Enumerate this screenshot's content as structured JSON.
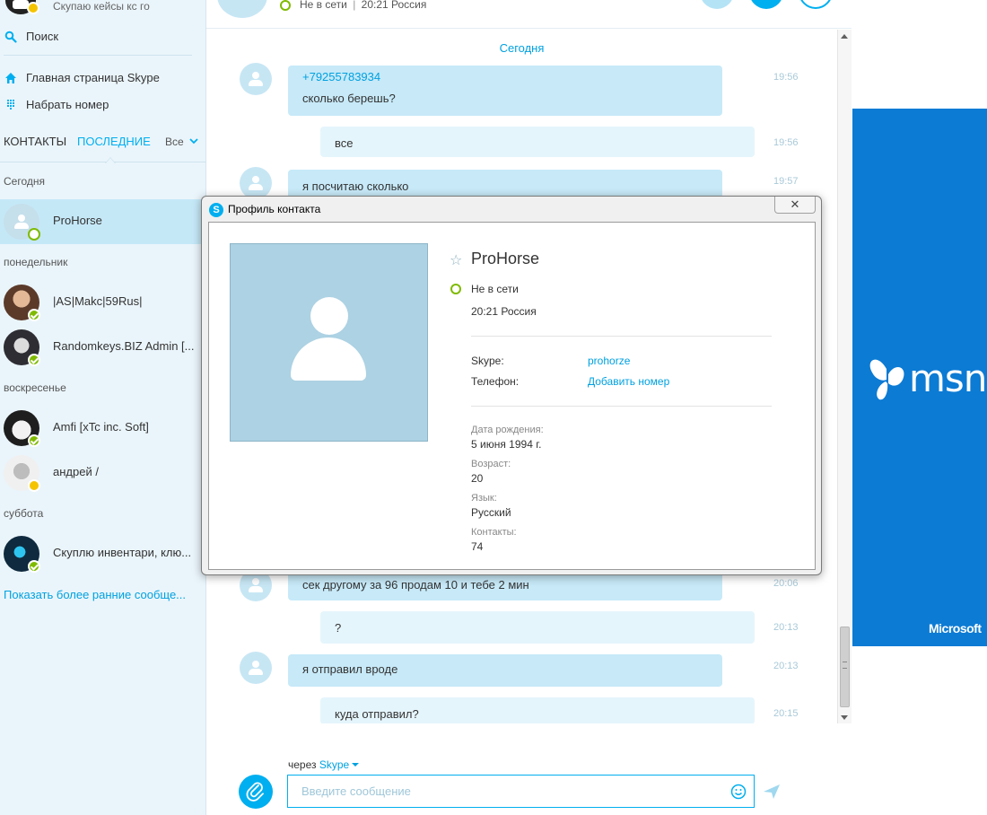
{
  "user": {
    "mood": "Скупаю кейсы кс го"
  },
  "nav": {
    "search": "Поиск",
    "home": "Главная страница Skype",
    "dial": "Набрать номер"
  },
  "tabs": {
    "contacts": "КОНТАКТЫ",
    "recent": "ПОСЛЕДНИЕ",
    "filter": "Все"
  },
  "groups": {
    "today": "Сегодня",
    "monday": "понедельник",
    "sunday": "воскресенье",
    "saturday": "суббота"
  },
  "contacts": [
    {
      "name": "ProHorse",
      "status": "offline"
    },
    {
      "name": "|AS|Makc|59Rus|",
      "status": "online"
    },
    {
      "name": "Randomkeys.BIZ Admin [...",
      "status": "online"
    },
    {
      "name": "Amfi [xTc inc. Soft]",
      "status": "online"
    },
    {
      "name": "андрей /",
      "status": "away"
    },
    {
      "name": "Скуплю инвентари, клю...",
      "status": "online"
    }
  ],
  "show_more": "Показать более ранние сообще...",
  "chat_header": {
    "status": "Не в сети",
    "sep": "|",
    "local_time": "20:21 Россия"
  },
  "chat": {
    "day": "Сегодня",
    "messages": [
      {
        "dir": "in",
        "lines": [
          "+79255783934",
          "сколько берешь?"
        ],
        "time": "19:56"
      },
      {
        "dir": "out",
        "lines": [
          "все"
        ],
        "time": "19:56"
      },
      {
        "dir": "in",
        "lines": [
          "я посчитаю сколько"
        ],
        "time": "19:57"
      },
      {
        "dir": "in",
        "lines": [
          "сек другому за 96 продам 10 и тебе 2 мин"
        ],
        "time": "20:06"
      },
      {
        "dir": "out",
        "lines": [
          "?"
        ],
        "time": "20:13"
      },
      {
        "dir": "in",
        "lines": [
          "я отправил вроде"
        ],
        "time": "20:13"
      },
      {
        "dir": "out",
        "lines": [
          "куда отправил?"
        ],
        "time": "20:15"
      }
    ]
  },
  "composer": {
    "via": "через",
    "via_service": "Skype",
    "placeholder": "Введите сообщение"
  },
  "ad": {
    "brand": "msn",
    "company": "Microsoft",
    "color": "#0c7bd4"
  },
  "profile": {
    "title": "Профиль контакта",
    "close_glyph": "✕",
    "name": "ProHorse",
    "status": "Не в сети",
    "local_time": "20:21 Россия",
    "skype_label": "Skype:",
    "skype_value": "prohorze",
    "phone_label": "Телефон:",
    "phone_value": "Добавить номер",
    "birthday_label": "Дата рождения:",
    "birthday_value": "5 июня 1994 г.",
    "age_label": "Возраст:",
    "age_value": "20",
    "language_label": "Язык:",
    "language_value": "Русский",
    "contacts_label": "Контакты:",
    "contacts_value": "74"
  },
  "colors": {
    "accent": "#00aff0",
    "online": "#7fba00",
    "away": "#f5c400",
    "sidebar_bg": "#eaf5fb"
  }
}
